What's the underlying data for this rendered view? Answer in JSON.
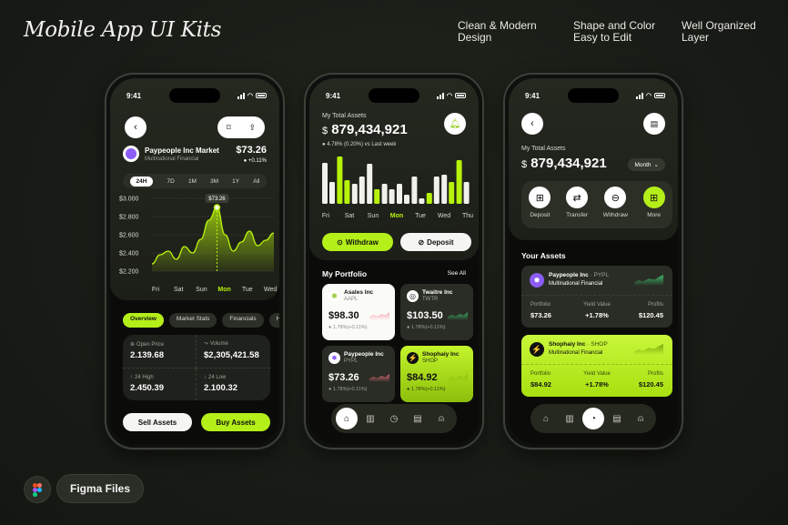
{
  "header": {
    "title": "Mobile App UI Kits",
    "features": [
      {
        "line1": "Clean & Modern",
        "line2": "Design"
      },
      {
        "line1": "Shape and Color",
        "line2": "Easy to Edit"
      },
      {
        "line1": "Well Organized",
        "line2": "Layer"
      }
    ]
  },
  "footer": {
    "badge_label": "Figma Files"
  },
  "status": {
    "time": "9:41"
  },
  "phone1": {
    "company": "Paypeople Inc Market",
    "company_sub": "Multinational Financial",
    "price": "$73.26",
    "change": "+0.11%",
    "ranges": [
      "24H",
      "7D",
      "1M",
      "3M",
      "1Y",
      "All"
    ],
    "active_range": "24H",
    "tooltip": "$73.26",
    "chart_data": {
      "type": "area",
      "x": [
        "Fri",
        "Sat",
        "Sun",
        "Mon",
        "Tue",
        "Wed"
      ],
      "y_ticks": [
        "$3.000",
        "$2.800",
        "$2.600",
        "$2.400",
        "$2.200"
      ],
      "ylim": [
        2200,
        3000
      ],
      "values": [
        2280,
        2380,
        2420,
        2330,
        2470,
        2400,
        2550,
        2760,
        2900,
        2600,
        2420,
        2520,
        2640,
        2480,
        2540,
        2620
      ],
      "highlight_label": "Mon",
      "color": "#b7f20c"
    },
    "tabs": [
      "Overview",
      "Market Stats",
      "Financials",
      "His"
    ],
    "active_tab": "Overview",
    "stats": [
      {
        "icon": "⊕",
        "label": "Open Price",
        "value": "2.139.68"
      },
      {
        "icon": "⤳",
        "label": "Volume",
        "value": "$2,305,421.58"
      },
      {
        "icon": "↑",
        "label": "24 High",
        "value": "2.450.39"
      },
      {
        "icon": "↓",
        "label": "24 Low",
        "value": "2.100.32"
      }
    ],
    "sell_label": "Sell Assets",
    "buy_label": "Buy Assets"
  },
  "phone2": {
    "total_label": "My Total Assets",
    "total_value": "879,434,921",
    "currency": "$",
    "change": "4.78% (0.20%) vs Last week",
    "chart_data": {
      "type": "bar",
      "categories": [
        "Fri",
        "Sat",
        "Sun",
        "Mon",
        "Tue",
        "Wed",
        "Thu"
      ],
      "series": [
        {
          "values": [
            45,
            52,
            22,
            44,
            22,
            22,
            30,
            12,
            32,
            48
          ]
        },
        {
          "values": [
            24,
            26,
            30,
            16,
            16,
            10,
            6,
            30,
            24,
            24
          ]
        }
      ],
      "active": "Mon"
    },
    "withdraw_label": "Withdraw",
    "deposit_label": "Deposit",
    "portfolio_title": "My Portfolio",
    "see_all": "See All",
    "cards": [
      {
        "name": "Asales Inc",
        "ticker": "AAPL",
        "price": "$98.30",
        "change": "1.78%(+0.11%)",
        "theme": "white"
      },
      {
        "name": "Twaitre Inc",
        "ticker": "TWTR",
        "price": "$103.50",
        "change": "1.78%(+0.11%)",
        "theme": "dark"
      },
      {
        "name": "Paypeople Inc",
        "ticker": "PYPL",
        "price": "$73.26",
        "change": "1.78%(+0.11%)",
        "theme": "dark"
      },
      {
        "name": "Shophaiy Inc",
        "ticker": "SHOP",
        "price": "$84.92",
        "change": "1.78%(+0.11%)",
        "theme": "lime"
      }
    ]
  },
  "phone3": {
    "total_label": "My Total Assets",
    "currency": "$",
    "total_value": "879,434,921",
    "period": "Month",
    "actions": [
      {
        "label": "Deposit",
        "icon": "deposit-icon"
      },
      {
        "label": "Transfer",
        "icon": "transfer-icon"
      },
      {
        "label": "Withdraw",
        "icon": "withdraw-icon"
      },
      {
        "label": "More",
        "icon": "grid-plus-icon"
      }
    ],
    "your_assets": "Your Assets",
    "assets": [
      {
        "name": "Paypeople Inc",
        "ticker": "PYPL",
        "sub": "Multinational Financial",
        "portfolio_label": "Portfolio",
        "portfolio": "$73.26",
        "yield_label": "Yield Value",
        "yield": "+1.78%",
        "profit_label": "Profits",
        "profit": "$120.45",
        "theme": "dark"
      },
      {
        "name": "Shophaiy Inc",
        "ticker": "SHOP",
        "sub": "Multinational Financial",
        "portfolio_label": "Portfolio",
        "portfolio": "$84.92",
        "yield_label": "Yield Value",
        "yield": "+1.78%",
        "profit_label": "Profits",
        "profit": "$120.45",
        "theme": "lime"
      }
    ]
  }
}
